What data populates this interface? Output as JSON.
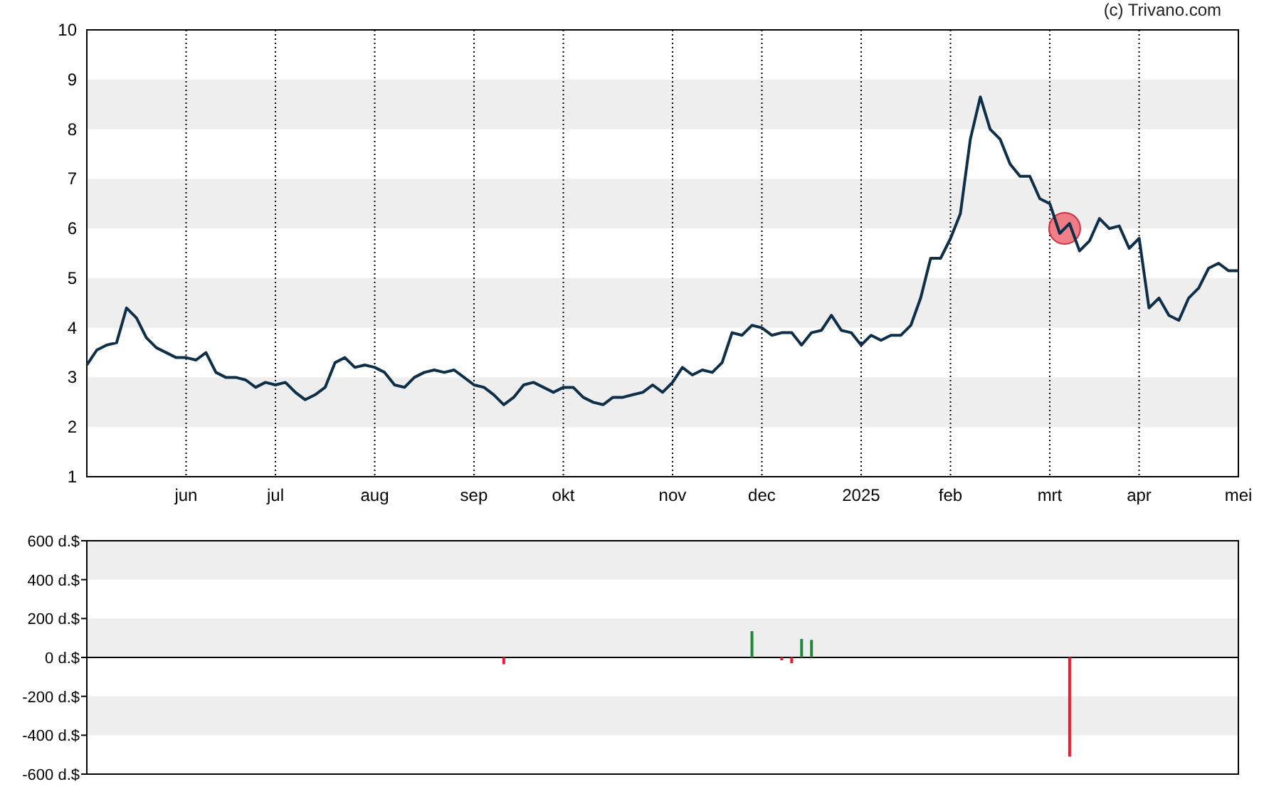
{
  "copyright": "(c) Trivano.com",
  "price_chart": {
    "chart_data": {
      "type": "line",
      "grid": true,
      "ylim": [
        1,
        10
      ],
      "yticks": [
        1,
        2,
        3,
        4,
        5,
        6,
        7,
        8,
        9,
        10
      ],
      "categories": [
        null,
        null,
        null,
        null,
        null,
        null,
        null,
        null,
        null,
        null,
        "jun",
        null,
        null,
        null,
        null,
        null,
        null,
        null,
        null,
        "jul",
        null,
        null,
        null,
        null,
        null,
        null,
        null,
        null,
        null,
        "aug",
        null,
        null,
        null,
        null,
        null,
        null,
        null,
        null,
        null,
        "sep",
        null,
        null,
        null,
        null,
        null,
        null,
        null,
        null,
        "okt",
        null,
        null,
        null,
        null,
        null,
        null,
        null,
        null,
        null,
        null,
        "nov",
        null,
        null,
        null,
        null,
        null,
        null,
        null,
        null,
        "dec",
        null,
        null,
        null,
        null,
        null,
        null,
        null,
        null,
        null,
        "2025",
        null,
        null,
        null,
        null,
        null,
        null,
        null,
        null,
        "feb",
        null,
        null,
        null,
        null,
        null,
        null,
        null,
        null,
        null,
        "mrt",
        null,
        null,
        null,
        null,
        null,
        null,
        null,
        null,
        "apr",
        null,
        null,
        null,
        null,
        null,
        null,
        null,
        null,
        null,
        "mei"
      ],
      "series": [
        {
          "color": "#0d2f4a",
          "values": [
            3.25,
            3.55,
            3.65,
            3.7,
            4.4,
            4.2,
            3.8,
            3.6,
            3.5,
            3.4,
            3.4,
            3.35,
            3.5,
            3.1,
            3.0,
            3.0,
            2.95,
            2.8,
            2.9,
            2.85,
            2.9,
            2.7,
            2.55,
            2.65,
            2.8,
            3.3,
            3.4,
            3.2,
            3.25,
            3.2,
            3.1,
            2.85,
            2.8,
            3.0,
            3.1,
            3.15,
            3.1,
            3.15,
            3.0,
            2.85,
            2.8,
            2.65,
            2.45,
            2.6,
            2.85,
            2.9,
            2.8,
            2.7,
            2.8,
            2.8,
            2.6,
            2.5,
            2.45,
            2.6,
            2.6,
            2.65,
            2.7,
            2.85,
            2.7,
            2.9,
            3.2,
            3.05,
            3.15,
            3.1,
            3.3,
            3.9,
            3.85,
            4.05,
            4.0,
            3.85,
            3.9,
            3.9,
            3.65,
            3.9,
            3.95,
            4.25,
            3.95,
            3.9,
            3.65,
            3.85,
            3.75,
            3.85,
            3.85,
            4.05,
            4.6,
            5.4,
            5.4,
            5.8,
            6.3,
            7.8,
            8.65,
            8.0,
            7.8,
            7.3,
            7.05,
            7.05,
            6.6,
            6.5,
            5.9,
            6.1,
            5.55,
            5.75,
            6.2,
            6.0,
            6.05,
            5.6,
            5.8,
            4.4,
            4.6,
            4.25,
            4.15,
            4.6,
            4.8,
            5.2,
            5.3,
            5.15,
            5.15
          ]
        }
      ]
    }
  },
  "trade_chart": {
    "chart_data": {
      "type": "bar",
      "ylim": [
        -600,
        600
      ],
      "yticks": [
        {
          "value": 600,
          "label": "600 d.$"
        },
        {
          "value": 400,
          "label": "400 d.$"
        },
        {
          "value": 200,
          "label": "200 d.$"
        },
        {
          "value": 0,
          "label": "0 d.$"
        },
        {
          "value": -200,
          "label": "-200 d.$"
        },
        {
          "value": -400,
          "label": "-400 d.$"
        },
        {
          "value": -600,
          "label": "-600 d.$"
        }
      ],
      "categories": [
        null,
        null,
        null,
        null,
        null,
        null,
        null,
        null,
        null,
        null,
        null,
        null,
        null,
        null,
        null,
        null,
        null,
        null,
        null,
        null,
        null,
        null,
        null,
        null,
        null,
        null,
        null,
        null,
        null,
        null,
        null,
        null,
        null,
        null,
        null,
        null,
        null,
        null,
        null,
        null,
        null,
        null,
        null,
        null,
        null,
        null,
        null,
        null,
        null,
        null,
        null,
        null,
        null,
        null,
        null,
        null,
        null,
        null,
        null,
        null,
        null,
        null,
        null,
        null,
        null,
        null,
        null,
        null,
        null,
        null,
        null,
        null,
        null,
        null,
        null,
        null,
        null,
        null,
        null,
        null,
        null,
        null,
        null,
        null,
        null,
        null,
        null,
        null,
        null,
        null,
        null,
        null,
        null,
        null,
        null,
        null,
        null,
        null,
        null,
        null,
        null,
        null,
        null,
        null,
        null,
        null,
        null,
        null,
        null,
        null,
        null,
        null,
        null,
        null,
        null,
        null,
        null
      ],
      "values": [
        null,
        null,
        null,
        null,
        null,
        null,
        null,
        null,
        null,
        null,
        null,
        null,
        null,
        null,
        null,
        null,
        null,
        null,
        null,
        null,
        null,
        null,
        null,
        null,
        null,
        null,
        null,
        null,
        null,
        null,
        null,
        null,
        null,
        null,
        null,
        null,
        null,
        null,
        null,
        null,
        null,
        null,
        -35,
        null,
        null,
        null,
        null,
        null,
        null,
        null,
        null,
        null,
        null,
        null,
        null,
        null,
        null,
        null,
        null,
        null,
        null,
        null,
        null,
        null,
        null,
        null,
        null,
        135,
        null,
        null,
        -15,
        -30,
        95,
        90,
        null,
        null,
        null,
        null,
        null,
        null,
        null,
        null,
        null,
        null,
        null,
        null,
        null,
        null,
        null,
        null,
        null,
        null,
        null,
        null,
        null,
        null,
        null,
        null,
        null,
        -510,
        null,
        null,
        null,
        null,
        null,
        null,
        null,
        null,
        null,
        null,
        null,
        null,
        null,
        null,
        null,
        null,
        null
      ]
    }
  }
}
